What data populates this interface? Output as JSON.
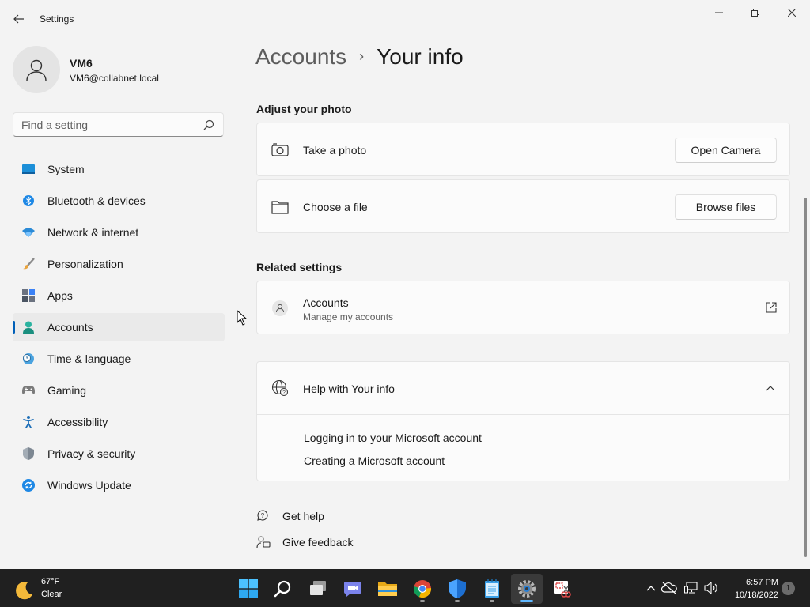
{
  "window": {
    "app_title": "Settings",
    "back_glyph": "←",
    "minimize_glyph": "—",
    "maximize_glyph": "❐",
    "close_glyph": "✕"
  },
  "profile": {
    "name": "VM6",
    "email": "VM6@collabnet.local"
  },
  "search": {
    "placeholder": "Find a setting"
  },
  "sidebar": {
    "items": [
      {
        "label": "System",
        "icon": "system-icon",
        "active": false
      },
      {
        "label": "Bluetooth & devices",
        "icon": "bluetooth-icon",
        "active": false
      },
      {
        "label": "Network & internet",
        "icon": "wifi-icon",
        "active": false
      },
      {
        "label": "Personalization",
        "icon": "brush-icon",
        "active": false
      },
      {
        "label": "Apps",
        "icon": "apps-icon",
        "active": false
      },
      {
        "label": "Accounts",
        "icon": "accounts-icon",
        "active": true
      },
      {
        "label": "Time & language",
        "icon": "clock-globe-icon",
        "active": false
      },
      {
        "label": "Gaming",
        "icon": "gamepad-icon",
        "active": false
      },
      {
        "label": "Accessibility",
        "icon": "accessibility-icon",
        "active": false
      },
      {
        "label": "Privacy & security",
        "icon": "shield-icon",
        "active": false
      },
      {
        "label": "Windows Update",
        "icon": "update-icon",
        "active": false
      }
    ]
  },
  "breadcrumb": {
    "parent": "Accounts",
    "separator": "›",
    "current": "Your info"
  },
  "adjust_photo": {
    "title": "Adjust your photo",
    "take_photo": {
      "label": "Take a photo",
      "button": "Open Camera"
    },
    "choose_file": {
      "label": "Choose a file",
      "button": "Browse files"
    }
  },
  "related": {
    "title": "Related settings",
    "accounts": {
      "label": "Accounts",
      "sub": "Manage my accounts"
    }
  },
  "help": {
    "title": "Help with Your info",
    "links": [
      "Logging in to your Microsoft account",
      "Creating a Microsoft account"
    ]
  },
  "footer": {
    "get_help": "Get help",
    "give_feedback": "Give feedback"
  },
  "taskbar": {
    "weather": {
      "temp": "67°F",
      "condition": "Clear"
    },
    "clock": {
      "time": "6:57 PM",
      "date": "10/18/2022"
    },
    "notification_count": "1",
    "apps": [
      "start-icon",
      "search-icon",
      "task-view-icon",
      "teams-chat-icon",
      "file-explorer-icon",
      "chrome-icon",
      "defender-icon",
      "notepad-icon",
      "settings-icon",
      "snipping-tool-icon"
    ]
  },
  "colors": {
    "accent": "#005fb8",
    "background": "#f3f3f3",
    "taskbar": "#202020"
  }
}
